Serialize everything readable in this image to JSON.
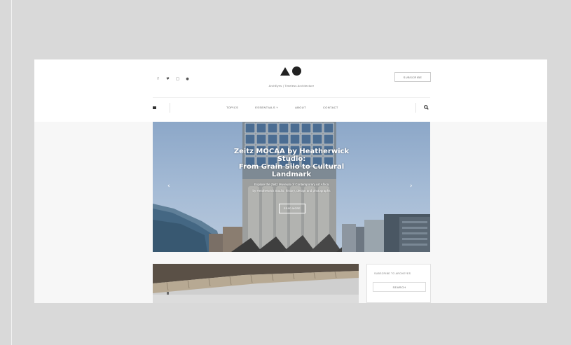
{
  "header": {
    "social_icons": [
      {
        "name": "facebook-icon",
        "glyph": "f"
      },
      {
        "name": "twitter-icon",
        "glyph": "♥"
      },
      {
        "name": "instagram-icon",
        "glyph": "□"
      },
      {
        "name": "pinterest-icon",
        "glyph": "●"
      }
    ],
    "tagline": "ArchEyes | Timeless Architecture",
    "subscribe_label": "SUBSCRIBE"
  },
  "nav": {
    "items": [
      "TOPICS",
      "ESSENTIALS ˅",
      "ABOUT",
      "CONTACT"
    ]
  },
  "hero": {
    "category": "",
    "title_line1": "Zeitz MOCAA by Heatherwick Studio:",
    "title_line2": "From Grain Silo to Cultural Landmark",
    "excerpt_line1": "Explore the Zeitz Museum of Contemporary Art Africa",
    "excerpt_line2": "by Heatherwick Studio: history, design and photographs",
    "button_label": "READ MORE",
    "prev_arrow": "‹",
    "next_arrow": "›"
  },
  "sidebar": {
    "subscribe_text": "SUBSCRIBE TO ARCHEYES",
    "search_label": "SEARCH"
  },
  "colors": {
    "page_background": "#d9d9d9",
    "frame_background": "#ffffff",
    "sky": "#8ca7c8",
    "text_dark": "#222222"
  }
}
